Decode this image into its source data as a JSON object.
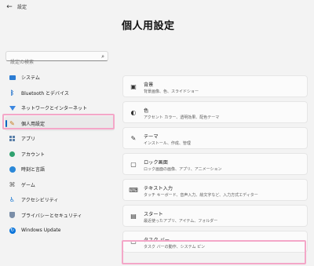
{
  "app": {
    "back_label": "←",
    "title": "設定"
  },
  "page": {
    "title": "個人用設定"
  },
  "search": {
    "placeholder": "設定の検索"
  },
  "sidebar": {
    "items": [
      {
        "label": "システム",
        "icon": "monitor-icon"
      },
      {
        "label": "Bluetooth とデバイス",
        "icon": "bluetooth-icon"
      },
      {
        "label": "ネットワークとインターネット",
        "icon": "wifi-icon"
      },
      {
        "label": "個人用設定",
        "icon": "brush-icon",
        "active": true
      },
      {
        "label": "アプリ",
        "icon": "apps-icon"
      },
      {
        "label": "アカウント",
        "icon": "person-icon"
      },
      {
        "label": "時刻と言語",
        "icon": "globe-icon"
      },
      {
        "label": "ゲーム",
        "icon": "gamepad-icon"
      },
      {
        "label": "アクセシビリティ",
        "icon": "accessibility-icon"
      },
      {
        "label": "プライバシーとセキュリティ",
        "icon": "shield-icon"
      },
      {
        "label": "Windows Update",
        "icon": "update-icon"
      }
    ]
  },
  "cards": [
    {
      "title": "背景",
      "subtitle": "背景画像、色、スライドショー",
      "icon": "image-icon"
    },
    {
      "title": "色",
      "subtitle": "アクセント カラー、透明効果、配色テーマ",
      "icon": "palette-icon"
    },
    {
      "title": "テーマ",
      "subtitle": "インストール、作成、管理",
      "icon": "brush-icon"
    },
    {
      "title": "ロック画面",
      "subtitle": "ロック画面の画像、アプリ、アニメーション",
      "icon": "lock-screen-icon"
    },
    {
      "title": "テキスト入力",
      "subtitle": "タッチ キーボード、音声入力、絵文字など、入力方式エディター",
      "icon": "keyboard-icon"
    },
    {
      "title": "スタート",
      "subtitle": "最近使ったアプリ、アイテム、フォルダー",
      "icon": "start-icon"
    },
    {
      "title": "タスク バー",
      "subtitle": "タスク バーの動作、システム ピン",
      "icon": "taskbar-icon"
    }
  ],
  "colors": {
    "accent": "#0067c0",
    "highlight": "#f4a7c8",
    "background": "#f3f3f3"
  }
}
